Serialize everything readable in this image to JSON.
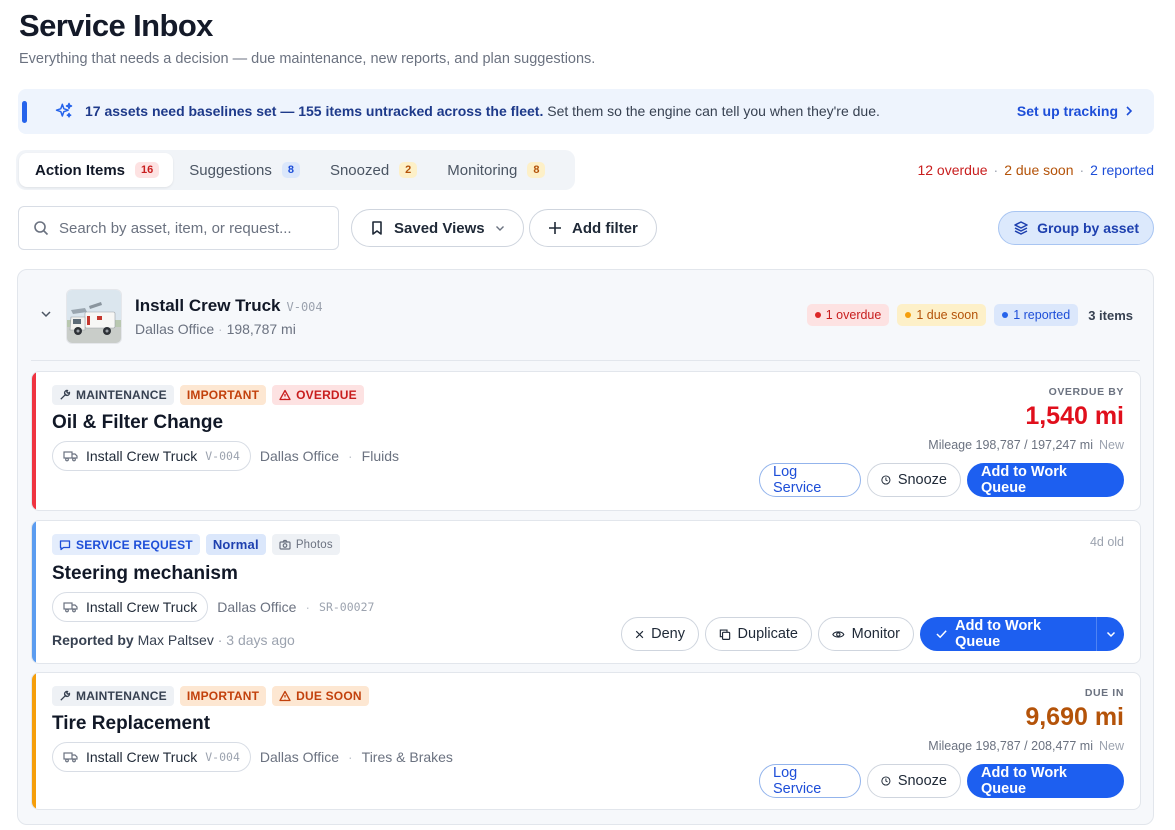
{
  "header": {
    "title": "Service Inbox",
    "subtitle": "Everything that needs a decision — due maintenance, new reports, and plan suggestions."
  },
  "banner": {
    "bold_text": "17 assets need baselines set — 155 items untracked across the fleet.",
    "text": " Set them so the engine can tell you when they're due.",
    "link_label": "Set up tracking"
  },
  "tabs": [
    {
      "label": "Action Items",
      "count": "16"
    },
    {
      "label": "Suggestions",
      "count": "8"
    },
    {
      "label": "Snoozed",
      "count": "2"
    },
    {
      "label": "Monitoring",
      "count": "8"
    }
  ],
  "summary": {
    "overdue": "12 overdue",
    "due_soon": "2 due soon",
    "reported": "2 reported",
    "separator": "·"
  },
  "toolbar": {
    "search_placeholder": "Search by asset, item, or request...",
    "saved_views_label": "Saved Views",
    "add_filter_label": "Add filter",
    "group_by_label": "Group by asset"
  },
  "colors": {
    "primary": "#1d5ff0",
    "overdue": "#e00f1c",
    "due_soon": "#b45309",
    "accent_red": "#ef3340",
    "accent_blue": "#5b9cf0",
    "accent_amber": "#f59e0b"
  },
  "group": {
    "asset_name": "Install Crew Truck",
    "asset_code": "V-004",
    "location": "Dallas Office",
    "mileage": "198,787 mi",
    "meta_separator": "·",
    "badge_overdue": "1 overdue",
    "badge_due_soon": "1 due soon",
    "badge_reported": "1 reported",
    "items_count": "3 items"
  },
  "cards": [
    {
      "category": "MAINTENANCE",
      "priority": "IMPORTANT",
      "status": "OVERDUE",
      "title": "Oil & Filter Change",
      "asset": "Install Crew Truck",
      "asset_code": "V-004",
      "location": "Dallas Office",
      "system": "Fluids",
      "right_label": "OVERDUE BY",
      "value": "1,540 mi",
      "mileage": "Mileage 198,787 / 197,247 mi",
      "mileage_tag": "New",
      "actions": [
        "Log Service",
        "Snooze",
        "Add to Work Queue"
      ]
    },
    {
      "category": "SERVICE REQUEST",
      "priority": "Normal",
      "attachment": "Photos",
      "title": "Steering mechanism",
      "asset": "Install Crew Truck",
      "location": "Dallas Office",
      "request_id": "SR-00027",
      "age": "4d old",
      "reported_label": "Reported by",
      "reporter": "Max Paltsev",
      "reported_ago": "· 3 days ago",
      "actions": [
        "Deny",
        "Duplicate",
        "Monitor",
        "Add to Work Queue"
      ]
    },
    {
      "category": "MAINTENANCE",
      "priority": "IMPORTANT",
      "status": "DUE SOON",
      "title": "Tire Replacement",
      "asset": "Install Crew Truck",
      "asset_code": "V-004",
      "location": "Dallas Office",
      "system": "Tires & Brakes",
      "right_label": "DUE IN",
      "value": "9,690 mi",
      "mileage": "Mileage 198,787 / 208,477 mi",
      "mileage_tag": "New",
      "actions": [
        "Log Service",
        "Snooze",
        "Add to Work Queue"
      ]
    }
  ]
}
